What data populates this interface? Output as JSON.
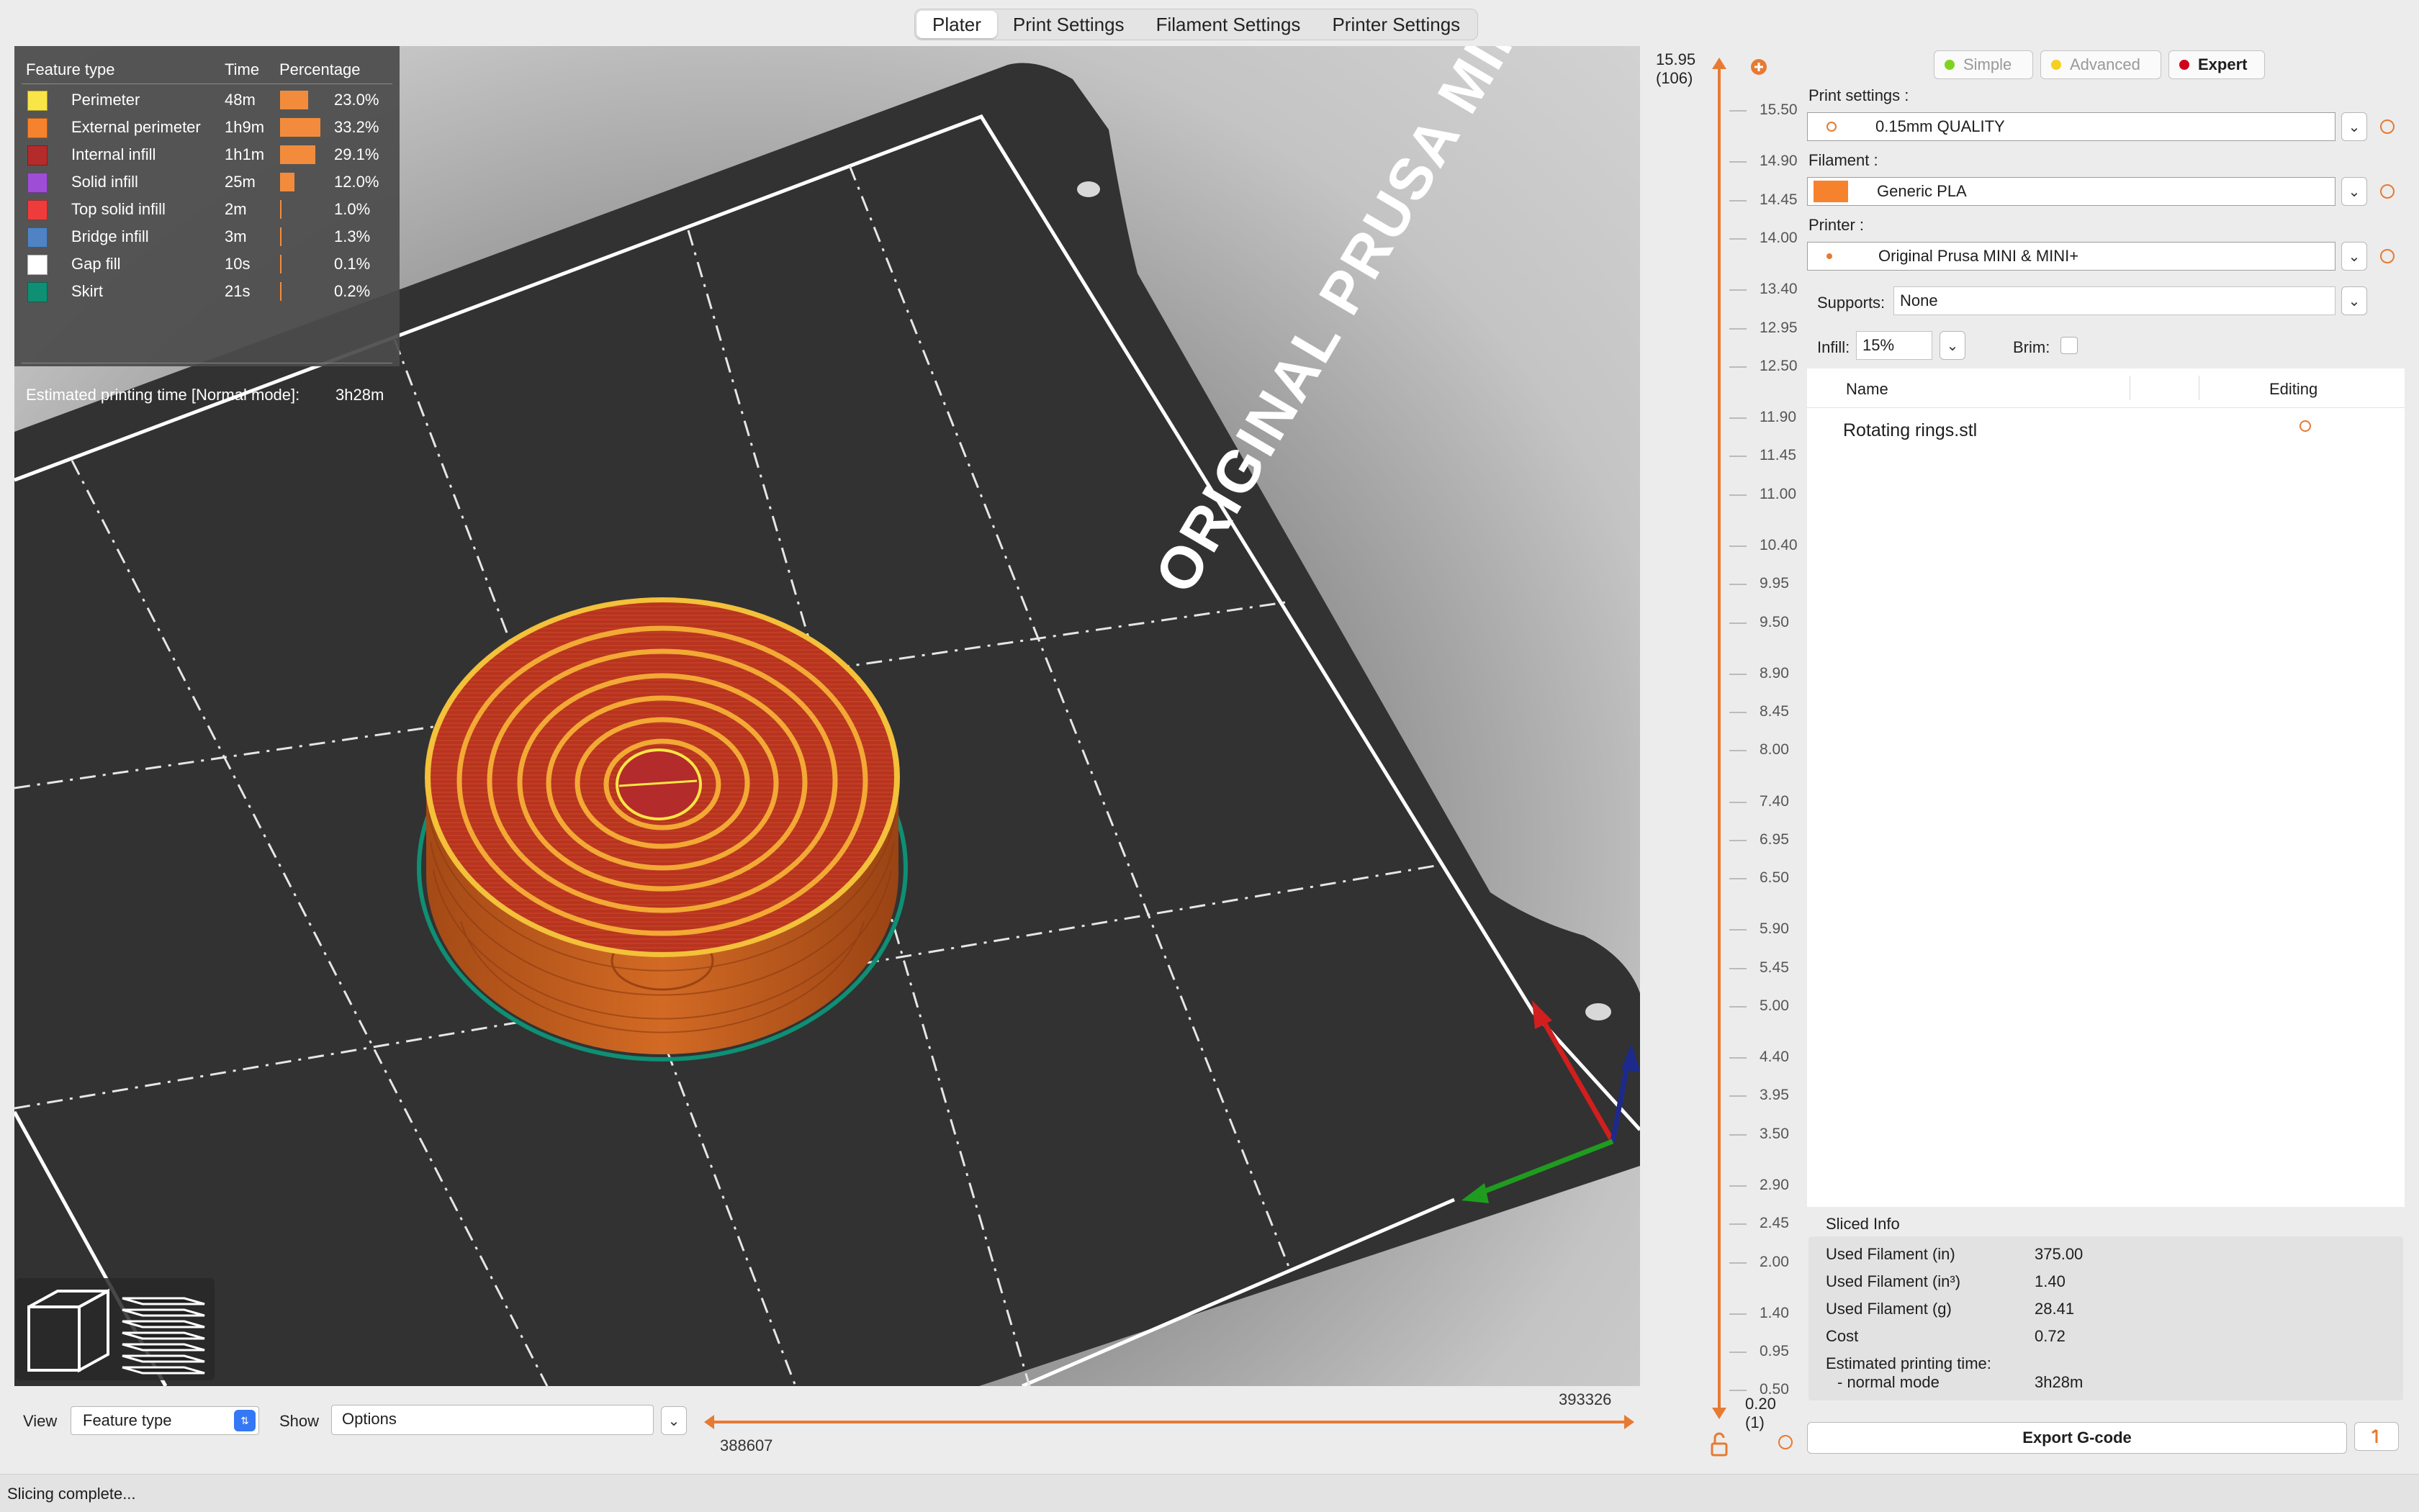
{
  "tabs": [
    "Plater",
    "Print Settings",
    "Filament Settings",
    "Printer Settings"
  ],
  "active_tab": "Plater",
  "bed_label": "ORIGINAL PRUSA MINI",
  "legend": {
    "col_feature": "Feature type",
    "col_time": "Time",
    "col_percentage": "Percentage",
    "rows": [
      {
        "name": "Perimeter",
        "time": "48m",
        "percent": "23.0%",
        "fraction": 0.23,
        "color": "#f9e546"
      },
      {
        "name": "External perimeter",
        "time": "1h9m",
        "percent": "33.2%",
        "fraction": 0.332,
        "color": "#f7822d"
      },
      {
        "name": "Internal infill",
        "time": "1h1m",
        "percent": "29.1%",
        "fraction": 0.291,
        "color": "#b42b2b"
      },
      {
        "name": "Solid infill",
        "time": "25m",
        "percent": "12.0%",
        "fraction": 0.12,
        "color": "#9e4ed6"
      },
      {
        "name": "Top solid infill",
        "time": "2m",
        "percent": "1.0%",
        "fraction": 0.01,
        "color": "#ee3c3c"
      },
      {
        "name": "Bridge infill",
        "time": "3m",
        "percent": "1.3%",
        "fraction": 0.013,
        "color": "#4f83c4"
      },
      {
        "name": "Gap fill",
        "time": "10s",
        "percent": "0.1%",
        "fraction": 0.001,
        "color": "#ffffff"
      },
      {
        "name": "Skirt",
        "time": "21s",
        "percent": "0.2%",
        "fraction": 0.002,
        "color": "#0f8f73"
      }
    ],
    "estimated_label": "Estimated printing time [Normal mode]:",
    "estimated_value": "3h28m"
  },
  "view_bar": {
    "view_label": "View",
    "view_value": "Feature type",
    "show_label": "Show",
    "show_value": "Options",
    "h_slider_max": "393326",
    "h_slider_min": "388607"
  },
  "vertical_slider": {
    "top_value": "15.95",
    "top_layer": "(106)",
    "bottom_value": "0.20",
    "bottom_layer": "(1)",
    "ticks": [
      "15.50",
      "14.90",
      "14.45",
      "14.00",
      "13.40",
      "12.95",
      "12.50",
      "11.90",
      "11.45",
      "11.00",
      "10.40",
      "9.95",
      "9.50",
      "8.90",
      "8.45",
      "8.00",
      "7.40",
      "6.95",
      "6.50",
      "5.90",
      "5.45",
      "5.00",
      "4.40",
      "3.95",
      "3.50",
      "2.90",
      "2.45",
      "2.00",
      "1.40",
      "0.95",
      "0.50"
    ]
  },
  "sidebar": {
    "modes": [
      {
        "label": "Simple",
        "color": "#7ed321",
        "active": false
      },
      {
        "label": "Advanced",
        "color": "#f5d020",
        "active": false
      },
      {
        "label": "Expert",
        "color": "#d0021b",
        "active": true
      }
    ],
    "print_settings_label": "Print settings :",
    "print_settings_value": "0.15mm QUALITY",
    "filament_label": "Filament :",
    "filament_value": "Generic PLA",
    "filament_color": "#f7822d",
    "printer_label": "Printer :",
    "printer_value": "Original Prusa MINI & MINI+",
    "supports_label": "Supports:",
    "supports_value": "None",
    "infill_label": "Infill:",
    "infill_value": "15%",
    "brim_label": "Brim:",
    "list_col_name": "Name",
    "list_col_editing": "Editing",
    "objects": [
      {
        "name": "Rotating rings.stl"
      }
    ]
  },
  "sliced_info": {
    "title": "Sliced Info",
    "rows": [
      {
        "k": "Used Filament (in)",
        "v": "375.00"
      },
      {
        "k": "Used Filament (in³)",
        "v": "1.40"
      },
      {
        "k": "Used Filament (g)",
        "v": "28.41"
      },
      {
        "k": "Cost",
        "v": "0.72"
      },
      {
        "k": "Estimated printing time:",
        "v": ""
      },
      {
        "k": "- normal mode",
        "v": "3h28m"
      }
    ]
  },
  "export_label": "Export G-code",
  "status": "Slicing complete...",
  "accent": "#e77a32"
}
